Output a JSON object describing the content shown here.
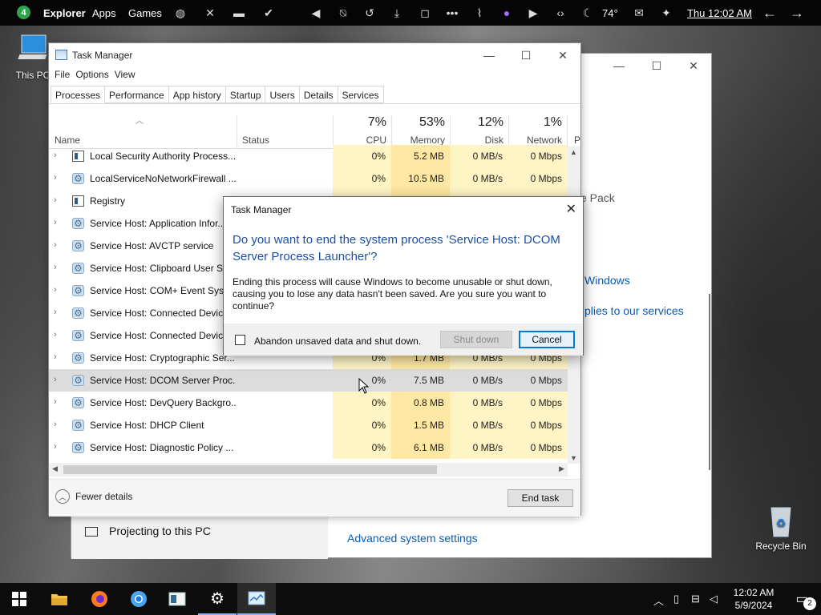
{
  "topbar": {
    "badge": "4",
    "items": [
      "Explorer",
      "Apps",
      "Games"
    ],
    "temperature": "74°",
    "clock": "Thu 12:02 AM"
  },
  "desktop": {
    "this_pc": "This PC",
    "recycle_bin": "Recycle Bin"
  },
  "bg_window": {
    "text_pack": "e Pack",
    "link_windows": "Windows",
    "link_services": "plies to our services",
    "projecting": "Projecting to this PC",
    "advanced": "Advanced system settings"
  },
  "taskmanager": {
    "title": "Task Manager",
    "menu": [
      "File",
      "Options",
      "View"
    ],
    "tabs": [
      "Processes",
      "Performance",
      "App history",
      "Startup",
      "Users",
      "Details",
      "Services"
    ],
    "columns": {
      "name": "Name",
      "status": "Status",
      "cpu_pct": "7%",
      "cpu": "CPU",
      "mem_pct": "53%",
      "mem": "Memory",
      "disk_pct": "12%",
      "disk": "Disk",
      "net_pct": "1%",
      "net": "Network",
      "p": "P"
    },
    "rows": [
      {
        "name": "Local Security Authority Process...",
        "cpu": "0%",
        "mem": "5.2 MB",
        "disk": "0 MB/s",
        "net": "0 Mbps",
        "icon": "window-icon"
      },
      {
        "name": "LocalServiceNoNetworkFirewall ...",
        "cpu": "0%",
        "mem": "10.5 MB",
        "disk": "0 MB/s",
        "net": "0 Mbps",
        "icon": "gear-icon"
      },
      {
        "name": "Registry",
        "cpu": "",
        "mem": "",
        "disk": "",
        "net": "",
        "icon": "window-icon"
      },
      {
        "name": "Service Host: Application Infor...",
        "cpu": "",
        "mem": "",
        "disk": "",
        "net": "",
        "icon": "gear-icon"
      },
      {
        "name": "Service Host: AVCTP service",
        "cpu": "",
        "mem": "",
        "disk": "",
        "net": "",
        "icon": "gear-icon"
      },
      {
        "name": "Service Host: Clipboard User Ser...",
        "cpu": "",
        "mem": "",
        "disk": "",
        "net": "",
        "icon": "gear-icon"
      },
      {
        "name": "Service Host: COM+ Event Syste...",
        "cpu": "",
        "mem": "",
        "disk": "",
        "net": "",
        "icon": "gear-icon"
      },
      {
        "name": "Service Host: Connected Device...",
        "cpu": "",
        "mem": "",
        "disk": "",
        "net": "",
        "icon": "gear-icon"
      },
      {
        "name": "Service Host: Connected Device...",
        "cpu": "",
        "mem": "",
        "disk": "",
        "net": "",
        "icon": "gear-icon"
      },
      {
        "name": "Service Host: Cryptographic Ser...",
        "cpu": "0%",
        "mem": "1.7 MB",
        "disk": "0 MB/s",
        "net": "0 Mbps",
        "icon": "gear-icon"
      },
      {
        "name": "Service Host: DCOM Server Proc...",
        "cpu": "0%",
        "mem": "7.5 MB",
        "disk": "0 MB/s",
        "net": "0 Mbps",
        "icon": "gear-icon",
        "selected": true
      },
      {
        "name": "Service Host: DevQuery Backgro...",
        "cpu": "0%",
        "mem": "0.8 MB",
        "disk": "0 MB/s",
        "net": "0 Mbps",
        "icon": "gear-icon"
      },
      {
        "name": "Service Host: DHCP Client",
        "cpu": "0%",
        "mem": "1.5 MB",
        "disk": "0 MB/s",
        "net": "0 Mbps",
        "icon": "gear-icon"
      },
      {
        "name": "Service Host: Diagnostic Policy ...",
        "cpu": "0%",
        "mem": "6.1 MB",
        "disk": "0 MB/s",
        "net": "0 Mbps",
        "icon": "gear-icon"
      }
    ],
    "fewer_details": "Fewer details",
    "end_task": "End task"
  },
  "dialog": {
    "title": "Task Manager",
    "question": "Do you want to end the system process 'Service Host: DCOM Server Process Launcher'?",
    "message": "Ending this process will cause Windows to become unusable or shut down, causing you to lose any data hasn't been saved. Are you sure you want to continue?",
    "checkbox_label": "Abandon unsaved data and shut down.",
    "shutdown_label": "Shut down",
    "cancel_label": "Cancel"
  },
  "taskbar": {
    "time": "12:02 AM",
    "date": "5/9/2024",
    "notifications": "2"
  }
}
